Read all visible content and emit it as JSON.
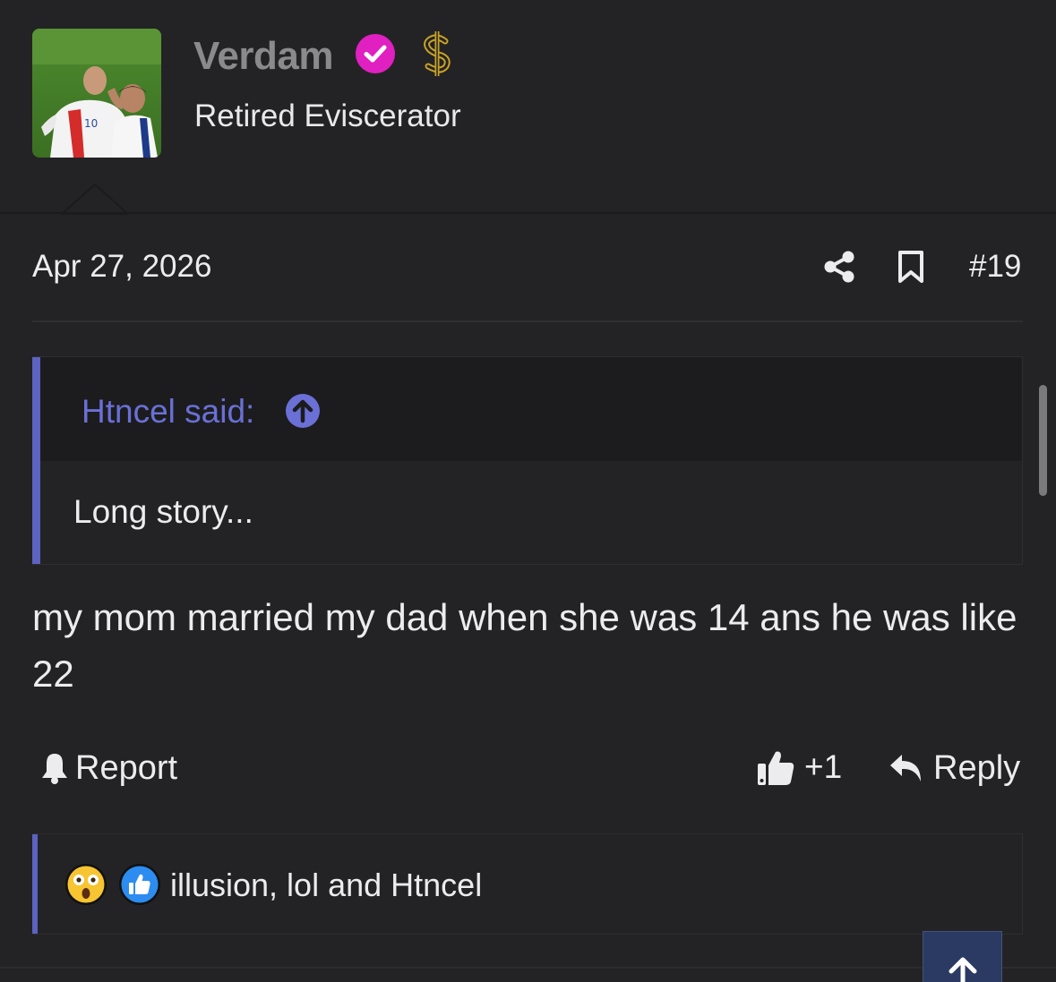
{
  "author": {
    "username": "Verdam",
    "user_title": "Retired Eviscerator",
    "verified_icon": "check-circle-icon",
    "badge_icon": "dollar-sign-icon",
    "username_color": "#8a8a8c",
    "verified_color": "#e020c0",
    "badge_color": "#c9a227"
  },
  "post": {
    "date": "Apr 27, 2026",
    "number": "#19",
    "quote": {
      "author_line": "Htncel said:",
      "text": "Long story..."
    },
    "message": "my mom married my dad when she was 14 ans he was like 22"
  },
  "actions": {
    "report_label": "Report",
    "like_count": "+1",
    "reply_label": "Reply"
  },
  "reactions": {
    "icons": [
      "astonished-emoji-icon",
      "like-reaction-icon"
    ],
    "text": "illusion, lol and Htncel"
  },
  "colors": {
    "accent": "#5c63c0",
    "quote_link": "#6a70d6",
    "background": "#232325"
  }
}
